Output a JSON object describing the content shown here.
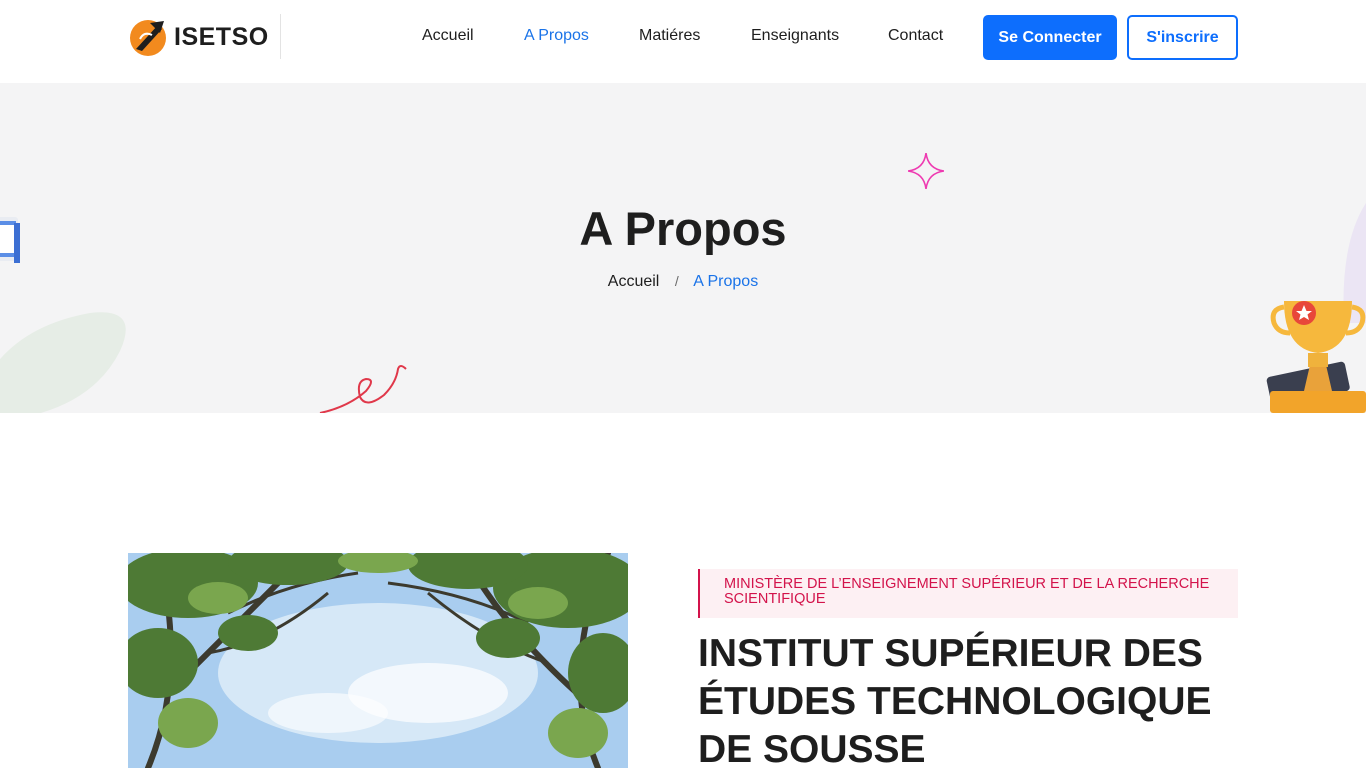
{
  "header": {
    "logo_text": "ISETSO",
    "nav": [
      {
        "label": "Accueil"
      },
      {
        "label": "A Propos"
      },
      {
        "label": "Matiéres"
      },
      {
        "label": "Enseignants"
      },
      {
        "label": "Contact"
      }
    ],
    "login_label": "Se Connecter",
    "signup_label": "S'inscrire"
  },
  "colors": {
    "accent": "#0d6efd",
    "active_link": "#1a73e8",
    "tag_red": "#d3134b",
    "hero_bg": "#f4f4f5"
  },
  "hero": {
    "title": "A Propos",
    "breadcrumb": {
      "home": "Accueil",
      "separator": "/",
      "current": "A Propos"
    }
  },
  "about": {
    "tag": "Ministère de l’enseignement supérieur et de la recherche scientifique",
    "title": "INSTITUT SUPÉRIEUR DES ÉTUDES TECHNOLOGIQUE DE SOUSSE"
  },
  "icons": [
    "logo-mark-icon",
    "sparkle-icon",
    "book-icon",
    "trophy-icon",
    "squiggle-icon",
    "leaf-blob-icon"
  ]
}
